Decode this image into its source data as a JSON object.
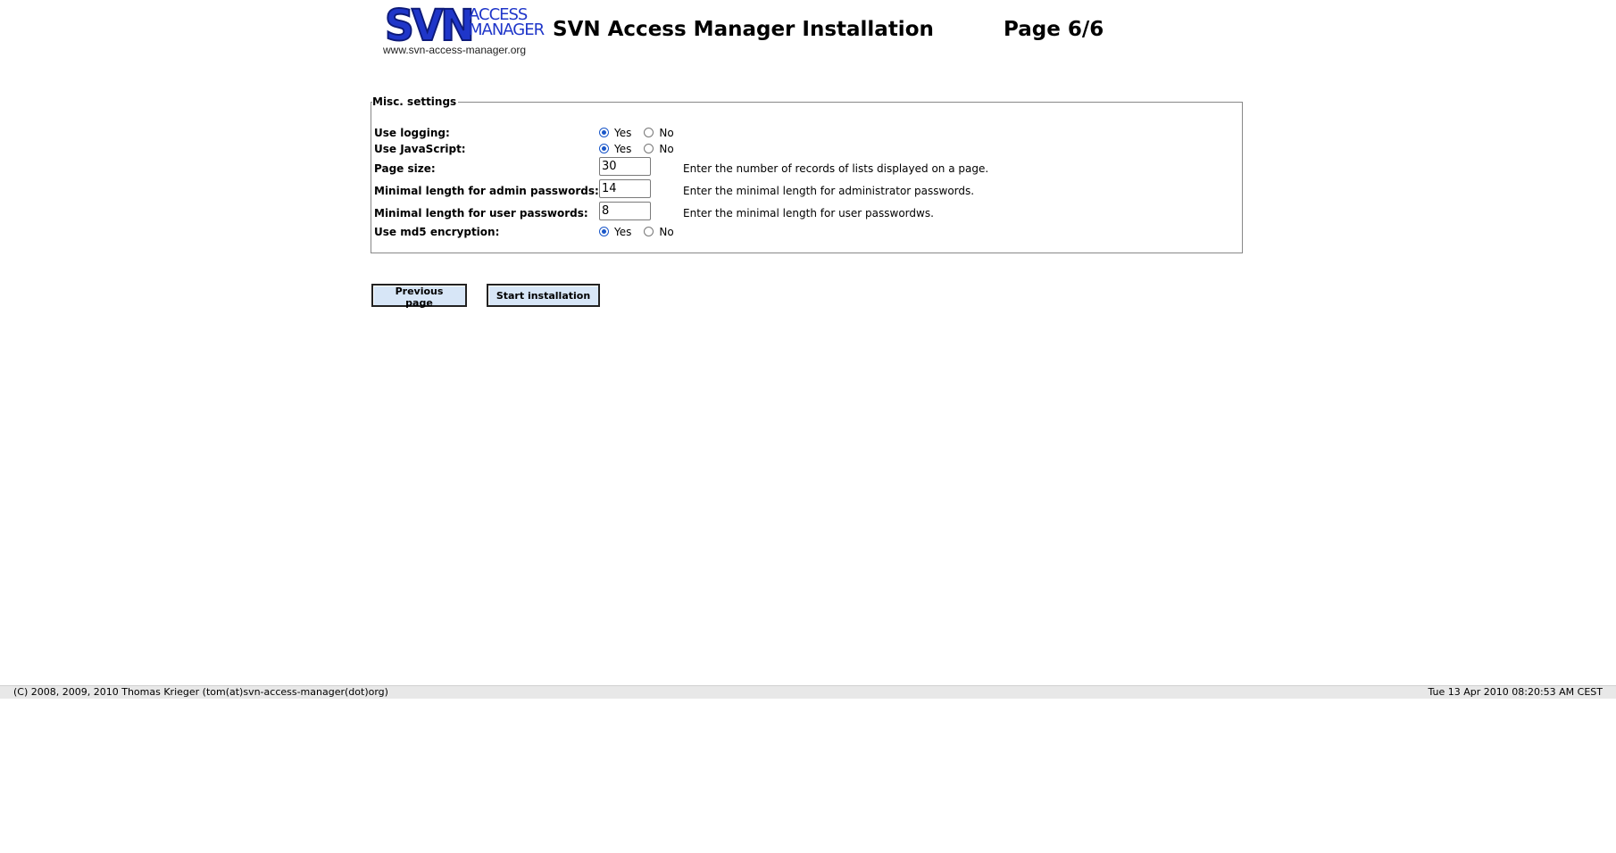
{
  "header": {
    "logo_main": "SVN",
    "logo_access": "ACCESS",
    "logo_manager": "MANAGER",
    "logo_url": "www.svn-access-manager.org",
    "title": "SVN Access Manager Installation",
    "page": "Page 6/6"
  },
  "form": {
    "legend": "Misc. settings",
    "rows": [
      {
        "label": "Use logging:",
        "yes": "Yes",
        "no": "No",
        "selected": "Yes"
      },
      {
        "label": "Use JavaScript:",
        "yes": "Yes",
        "no": "No",
        "selected": "Yes"
      },
      {
        "label": "Page size:",
        "value": "30",
        "help": "Enter the number of records of lists displayed on a page."
      },
      {
        "label": "Minimal length for admin passwords:",
        "value": "14",
        "help": "Enter the minimal length for administrator passwords."
      },
      {
        "label": "Minimal length for user passwords:",
        "value": "8",
        "help": "Enter the minimal length for user passwordws."
      },
      {
        "label": "Use md5 encryption:",
        "yes": "Yes",
        "no": "No",
        "selected": "Yes"
      }
    ]
  },
  "buttons": {
    "previous": "Previous page",
    "start": "Start installation"
  },
  "footer": {
    "copyright": "(C) 2008, 2009, 2010 Thomas Krieger (tom(at)svn-access-manager(dot)org)",
    "timestamp": "Tue 13 Apr 2010 08:20:53 AM CEST"
  },
  "colors": {
    "logo_blue": "#1f36c9",
    "button_bg": "#d7e6f7",
    "footer_bg": "#e8e8e8",
    "radio_accent": "#1a57c9"
  }
}
